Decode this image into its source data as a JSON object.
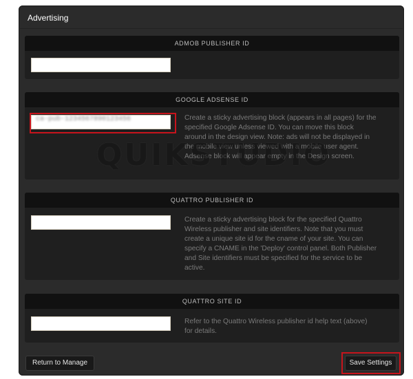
{
  "tab": {
    "title": "Advertising"
  },
  "sections": {
    "admob": {
      "header": "ADMOB PUBLISHER ID",
      "value": "",
      "help": ""
    },
    "adsense": {
      "header": "GOOGLE ADSENSE ID",
      "value": "ca-pub-1234567890123456",
      "help": "Create a sticky advertising block (appears in all pages) for the specified Google Adsense ID. You can move this block around in the design view. Note: ads will not be displayed in the mobile view unless viewed with a mobile user agent. Adsense block will appear empty in the Design screen."
    },
    "quattro_publisher": {
      "header": "QUATTRO PUBLISHER ID",
      "value": "",
      "help": "Create a sticky advertising block for the specified Quattro Wireless publisher and site identifiers. Note that you must create a unique site id for the cname of your site. You can specify a CNAME in the 'Deploy' control panel. Both Publisher and Site identifiers must be specified for the service to be active."
    },
    "quattro_site": {
      "header": "QUATTRO SITE ID",
      "value": "",
      "help": "Refer to the Quattro Wireless publisher id help text (above) for details."
    }
  },
  "buttons": {
    "return_label": "Return to Manage",
    "save_label": "Save Settings"
  },
  "watermark": "QUIKSTUDIO",
  "colors": {
    "panel": "#2b2b2b",
    "section": "#1f1f1f",
    "section_header": "#111111",
    "highlight": "#c8141c"
  }
}
